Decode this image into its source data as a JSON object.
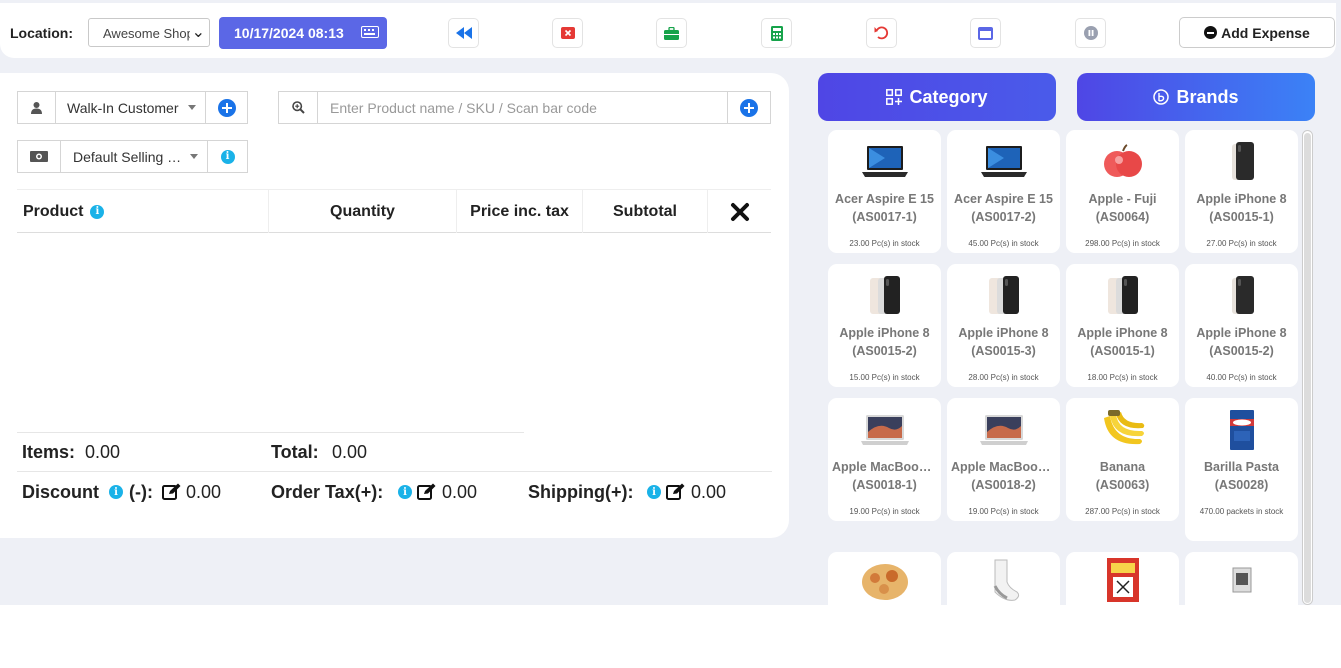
{
  "topbar": {
    "location_label": "Location:",
    "location_value": "Awesome Shop",
    "datetime": "10/17/2024 08:13",
    "add_expense": "Add Expense"
  },
  "left": {
    "customer": "Walk-In Customer",
    "search_placeholder": "Enter Product name / SKU / Scan bar code",
    "price_group": "Default Selling Price",
    "table": {
      "headers": {
        "product": "Product",
        "quantity": "Quantity",
        "price": "Price inc. tax",
        "subtotal": "Subtotal"
      }
    },
    "totals": {
      "items_label": "Items:",
      "items_value": "0.00",
      "total_label": "Total:",
      "total_value": "0.00",
      "discount_label_a": "Discount",
      "discount_label_b": "(-):",
      "discount_value": "0.00",
      "tax_label": "Order Tax(+):",
      "tax_value": "0.00",
      "shipping_label": "Shipping(+):",
      "shipping_value": "0.00"
    }
  },
  "right": {
    "category_label": "Category",
    "brands_label": "Brands",
    "products": [
      {
        "name": "Acer Aspire E 15",
        "sku": "(AS0017-1)",
        "stock": "23.00 Pc(s) in stock",
        "icon": "laptop"
      },
      {
        "name": "Acer Aspire E 15",
        "sku": "(AS0017-2)",
        "stock": "45.00 Pc(s) in stock",
        "icon": "laptop"
      },
      {
        "name": "Apple - Fuji",
        "sku": "(AS0064)",
        "stock": "298.00 Pc(s) in stock",
        "icon": "apple-fruit"
      },
      {
        "name": "Apple iPhone 8",
        "sku": "(AS0015-1)",
        "stock": "27.00 Pc(s) in stock",
        "icon": "phone-single"
      },
      {
        "name": "Apple iPhone 8",
        "sku": "(AS0015-2)",
        "stock": "15.00 Pc(s) in stock",
        "icon": "phone-pair"
      },
      {
        "name": "Apple iPhone 8",
        "sku": "(AS0015-3)",
        "stock": "28.00 Pc(s) in stock",
        "icon": "phone-pair"
      },
      {
        "name": "Apple iPhone 8",
        "sku": "(AS0015-1)",
        "stock": "18.00 Pc(s) in stock",
        "icon": "phone-pair"
      },
      {
        "name": "Apple iPhone 8",
        "sku": "(AS0015-2)",
        "stock": "40.00 Pc(s) in stock",
        "icon": "phone-single"
      },
      {
        "name": "Apple MacBook Air",
        "sku": "(AS0018-1)",
        "stock": "19.00 Pc(s) in stock",
        "icon": "macbook"
      },
      {
        "name": "Apple MacBook Air",
        "sku": "(AS0018-2)",
        "stock": "19.00 Pc(s) in stock",
        "icon": "macbook"
      },
      {
        "name": "Banana",
        "sku": "(AS0063)",
        "stock": "287.00 Pc(s) in stock",
        "icon": "banana"
      },
      {
        "name": "Barilla Pasta",
        "sku": "(AS0028)",
        "stock": "470.00 packets in stock",
        "icon": "pasta-box"
      },
      {
        "name": "",
        "sku": "",
        "stock": "",
        "icon": "pizza"
      },
      {
        "name": "",
        "sku": "",
        "stock": "",
        "icon": "sock"
      },
      {
        "name": "",
        "sku": "",
        "stock": "",
        "icon": "book"
      },
      {
        "name": "",
        "sku": "",
        "stock": "",
        "icon": "small-product"
      }
    ]
  },
  "colors": {
    "accent": "#5b67e6",
    "category_gradient": [
      "#4f46e5",
      "#3b82f6"
    ],
    "info": "#1ab2e8",
    "plus": "#1a73e8"
  }
}
